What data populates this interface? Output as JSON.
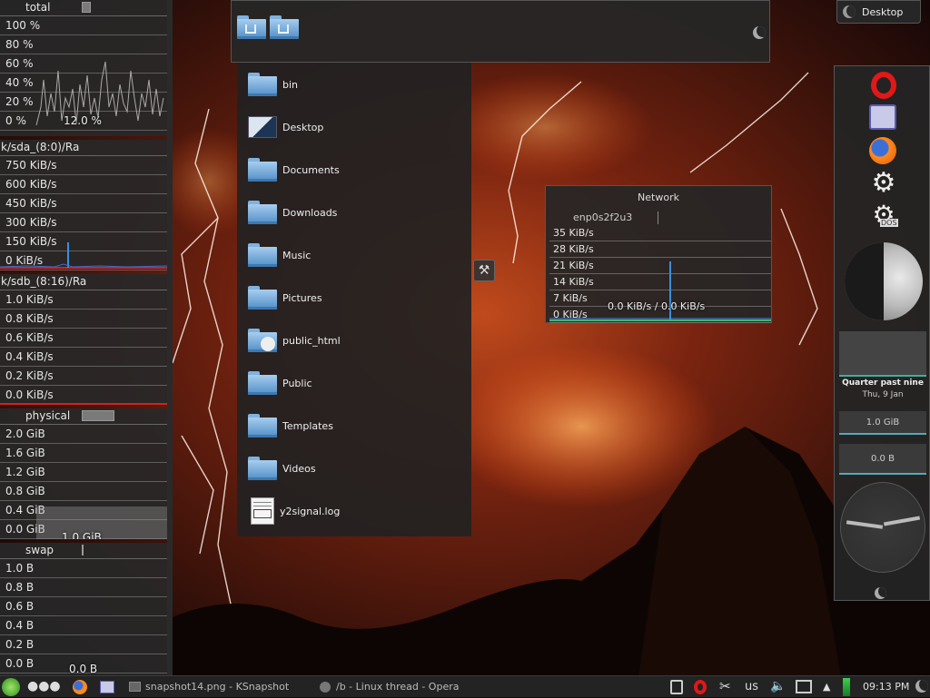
{
  "colors": {
    "accent": "#4a90d9",
    "net_spike": "#3a8fe0",
    "red_line": "#d22222"
  },
  "cpu": {
    "title": "total",
    "rows": [
      "100 %",
      "80 %",
      "60 %",
      "40 %",
      "20 %",
      "0 %"
    ],
    "overlay": "12.0 %"
  },
  "disk_a": {
    "title": "k/sda_(8:0)/Ra",
    "rows": [
      "750 KiB/s",
      "600 KiB/s",
      "450 KiB/s",
      "300 KiB/s",
      "150 KiB/s",
      "0 KiB/s"
    ]
  },
  "disk_b": {
    "title": "k/sdb_(8:16)/Ra",
    "rows": [
      "1.0 KiB/s",
      "0.8 KiB/s",
      "0.6 KiB/s",
      "0.4 KiB/s",
      "0.2 KiB/s",
      "0.0 KiB/s"
    ]
  },
  "memory": {
    "title": "physical",
    "rows": [
      "2.0 GiB",
      "1.6 GiB",
      "1.2 GiB",
      "0.8 GiB",
      "0.4 GiB",
      "0.0 GiB"
    ],
    "overlay": "1.0 GiB"
  },
  "swap": {
    "title": "swap",
    "rows": [
      "1.0 B",
      "0.8 B",
      "0.6 B",
      "0.4 B",
      "0.2 B",
      "0.0 B"
    ],
    "overlay": "0.0 B"
  },
  "places": {
    "items": [
      "home-folder-icon",
      "home-folder-icon"
    ]
  },
  "files": [
    {
      "name": "bin",
      "icon": "folder-icon"
    },
    {
      "name": "Desktop",
      "icon": "desktop-folder-icon"
    },
    {
      "name": "Documents",
      "icon": "folder-icon"
    },
    {
      "name": "Downloads",
      "icon": "folder-icon"
    },
    {
      "name": "Music",
      "icon": "folder-icon"
    },
    {
      "name": "Pictures",
      "icon": "folder-icon"
    },
    {
      "name": "public_html",
      "icon": "folder-icon"
    },
    {
      "name": "Public",
      "icon": "folder-icon"
    },
    {
      "name": "Templates",
      "icon": "folder-icon"
    },
    {
      "name": "Videos",
      "icon": "folder-icon"
    },
    {
      "name": "y2signal.log",
      "icon": "log-file-icon"
    }
  ],
  "network": {
    "title": "Network",
    "interface": "enp0s2f2u3",
    "rows": [
      "35 KiB/s",
      "28 KiB/s",
      "21 KiB/s",
      "14 KiB/s",
      "7 KiB/s",
      "0 KiB/s"
    ],
    "overlay": "0.0 KiB/s / 0.0 KiB/s"
  },
  "desktop_button": {
    "label": "Desktop"
  },
  "right_panel": {
    "clock": {
      "time_text": "Quarter past nine",
      "date": "Thu, 9 Jan"
    },
    "mem_gauge": "1.0 GiB",
    "swap_gauge": "0.0 B",
    "icons": [
      "opera-icon",
      "cursor-app-icon",
      "firefox-icon",
      "gear-icon",
      "dos-gear-icon"
    ],
    "moon_icon": "moon-phase-icon"
  },
  "taskbar": {
    "tasks": [
      {
        "label": "snapshot14.png - KSnapshot"
      },
      {
        "label": "/b - Linux thread - Opera"
      }
    ],
    "kbd": "us",
    "time": "09:13 PM"
  }
}
